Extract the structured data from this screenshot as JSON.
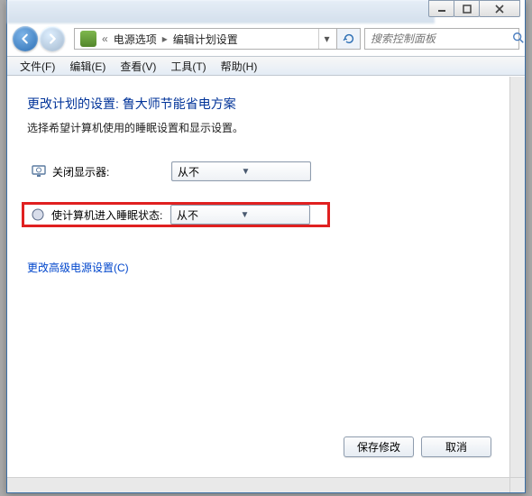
{
  "breadcrumb": {
    "items": [
      "电源选项",
      "编辑计划设置"
    ]
  },
  "search": {
    "placeholder": "搜索控制面板"
  },
  "menubar": {
    "file": "文件(F)",
    "edit": "编辑(E)",
    "view": "查看(V)",
    "tools": "工具(T)",
    "help": "帮助(H)"
  },
  "page": {
    "title": "更改计划的设置: 鲁大师节能省电方案",
    "subtitle": "选择希望计算机使用的睡眠设置和显示设置。"
  },
  "settings": {
    "display_off": {
      "label": "关闭显示器:",
      "value": "从不"
    },
    "sleep": {
      "label": "使计算机进入睡眠状态:",
      "value": "从不"
    }
  },
  "advanced_link": "更改高级电源设置(C)",
  "buttons": {
    "save": "保存修改",
    "cancel": "取消"
  }
}
